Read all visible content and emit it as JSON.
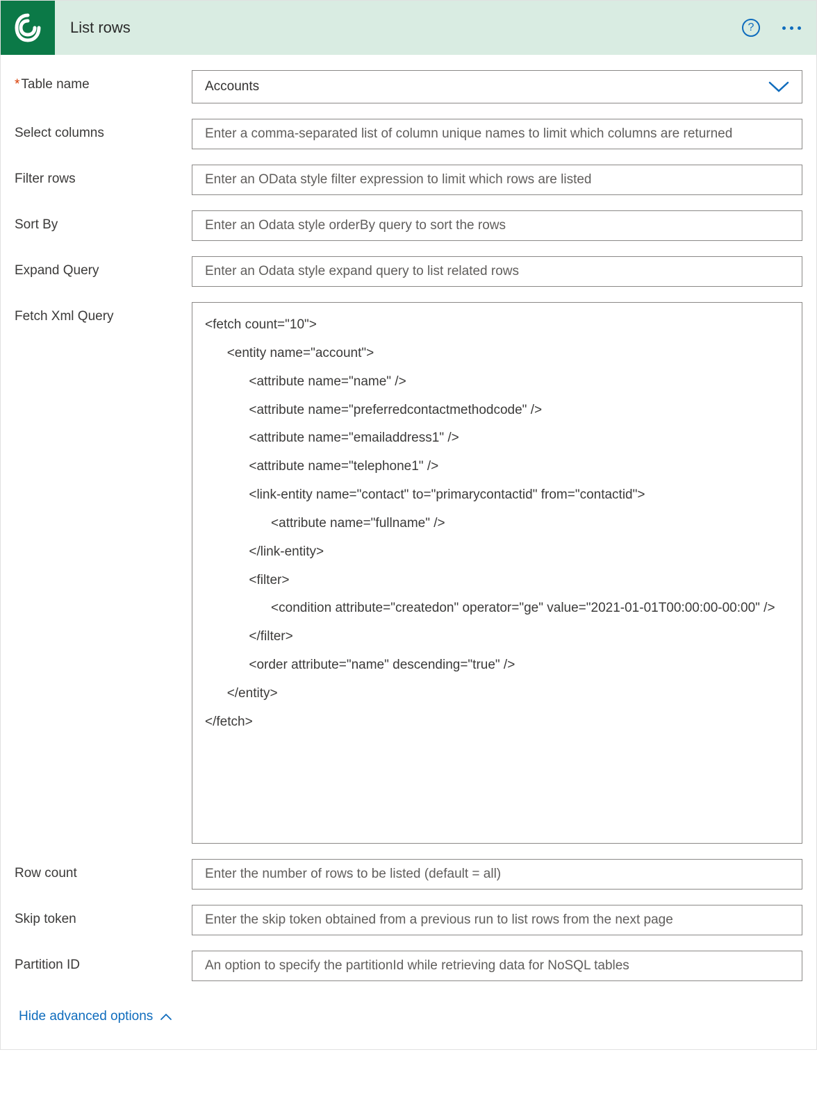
{
  "header": {
    "title": "List rows"
  },
  "fields": {
    "tableName": {
      "label": "Table name",
      "value": "Accounts"
    },
    "selectColumns": {
      "label": "Select columns",
      "placeholder": "Enter a comma-separated list of column unique names to limit which columns are returned"
    },
    "filterRows": {
      "label": "Filter rows",
      "placeholder": "Enter an OData style filter expression to limit which rows are listed"
    },
    "sortBy": {
      "label": "Sort By",
      "placeholder": "Enter an Odata style orderBy query to sort the rows"
    },
    "expandQuery": {
      "label": "Expand Query",
      "placeholder": "Enter an Odata style expand query to list related rows"
    },
    "fetchXml": {
      "label": "Fetch Xml Query",
      "value": "<fetch count=\"10\">\n      <entity name=\"account\">\n            <attribute name=\"name\" />\n            <attribute name=\"preferredcontactmethodcode\" />\n            <attribute name=\"emailaddress1\" />\n            <attribute name=\"telephone1\" />\n            <link-entity name=\"contact\" to=\"primarycontactid\" from=\"contactid\">\n                  <attribute name=\"fullname\" />\n            </link-entity>\n            <filter>\n                  <condition attribute=\"createdon\" operator=\"ge\" value=\"2021-01-01T00:00:00-00:00\" />\n            </filter>\n            <order attribute=\"name\" descending=\"true\" />\n      </entity>\n</fetch>"
    },
    "rowCount": {
      "label": "Row count",
      "placeholder": "Enter the number of rows to be listed (default = all)"
    },
    "skipToken": {
      "label": "Skip token",
      "placeholder": "Enter the skip token obtained from a previous run to list rows from the next page"
    },
    "partitionId": {
      "label": "Partition ID",
      "placeholder": "An option to specify the partitionId while retrieving data for NoSQL tables"
    }
  },
  "footer": {
    "toggleLabel": "Hide advanced options"
  }
}
